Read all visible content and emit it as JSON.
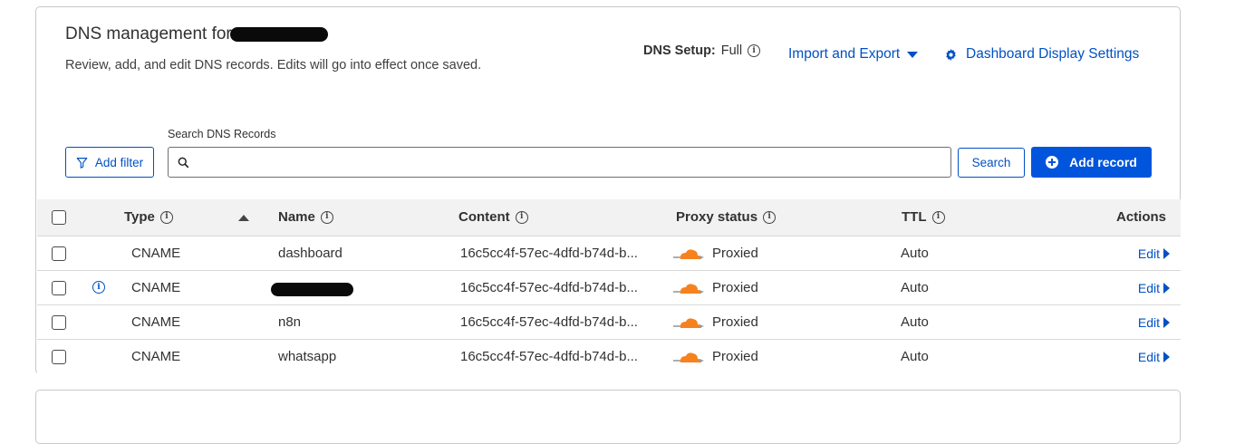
{
  "header": {
    "title": "DNS management for",
    "description": "Review, add, and edit DNS records. Edits will go into effect once saved.",
    "dns_setup_label": "DNS Setup:",
    "dns_setup_value": "Full",
    "import_export_label": "Import and Export",
    "display_settings_label": "Dashboard Display Settings"
  },
  "toolbar": {
    "add_filter_label": "Add filter",
    "search_label": "Search DNS Records",
    "search_placeholder": "",
    "search_button_label": "Search",
    "add_record_label": "Add record"
  },
  "table": {
    "columns": {
      "type": "Type",
      "name": "Name",
      "content": "Content",
      "proxy": "Proxy status",
      "ttl": "TTL",
      "actions": "Actions"
    },
    "rows": [
      {
        "type": "CNAME",
        "name": "dashboard",
        "content": "16c5cc4f-57ec-4dfd-b74d-b...",
        "proxy": "Proxied",
        "ttl": "Auto",
        "edit": "Edit"
      },
      {
        "type": "CNAME",
        "name": "",
        "content": "16c5cc4f-57ec-4dfd-b74d-b...",
        "proxy": "Proxied",
        "ttl": "Auto",
        "edit": "Edit"
      },
      {
        "type": "CNAME",
        "name": "n8n",
        "content": "16c5cc4f-57ec-4dfd-b74d-b...",
        "proxy": "Proxied",
        "ttl": "Auto",
        "edit": "Edit"
      },
      {
        "type": "CNAME",
        "name": "whatsapp",
        "content": "16c5cc4f-57ec-4dfd-b74d-b...",
        "proxy": "Proxied",
        "ttl": "Auto",
        "edit": "Edit"
      }
    ]
  },
  "colors": {
    "link": "#0051c3",
    "primary": "#0055dc",
    "cloud": "#f6821f"
  }
}
